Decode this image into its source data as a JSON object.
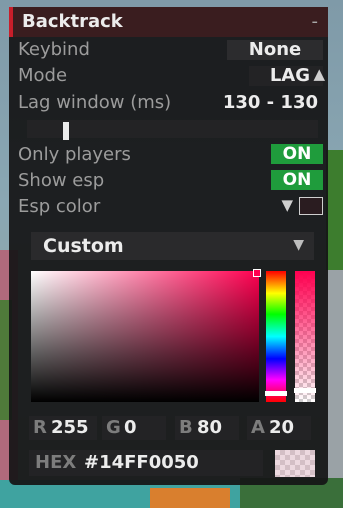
{
  "module": {
    "title": "Backtrack",
    "collapse_symbol": "-"
  },
  "settings": {
    "keybind": {
      "label": "Keybind",
      "value": "None"
    },
    "mode": {
      "label": "Mode",
      "value": "LAG",
      "arrow": "▲"
    },
    "lag_window": {
      "label": "Lag window (ms)",
      "value": "130 - 130",
      "level": 0.06
    },
    "only_players": {
      "label": "Only players",
      "value": "ON"
    },
    "show_esp": {
      "label": "Show esp",
      "value": "ON"
    },
    "esp_color": {
      "label": "Esp color",
      "arrow": "▼"
    }
  },
  "color_picker": {
    "preset": "Custom",
    "preset_arrow": "▼",
    "r_label": "R",
    "r_value": "255",
    "g_label": "G",
    "g_value": "0",
    "b_label": "B",
    "b_value": "80",
    "a_label": "A",
    "a_value": "20",
    "hex_label": "HEX",
    "hex_value": "#14FF0050"
  },
  "colors": {
    "accent": "#c81e2a",
    "toggle_on": "#1f9c3c",
    "picked": "#ff0050"
  }
}
